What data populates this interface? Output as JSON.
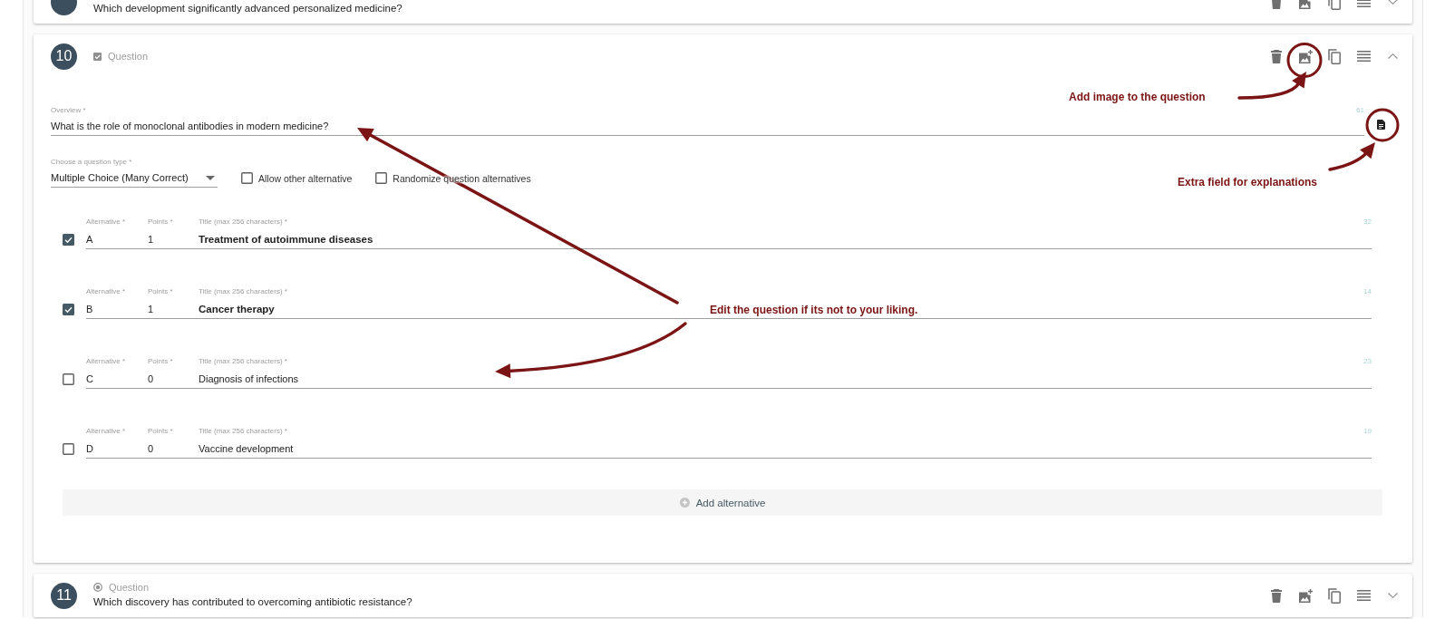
{
  "questions": [
    {
      "text": "Which development significantly advanced personalized medicine?",
      "expanded": false
    },
    {
      "number": "10",
      "type_label": "Question",
      "kind": "multiple",
      "expanded": true,
      "overview": {
        "label": "Overview *",
        "value": "What is the role of monoclonal antibodies in modern medicine?",
        "counter": "61"
      },
      "question_type": {
        "label": "Choose a question type *",
        "value": "Multiple Choice (Many Correct)"
      },
      "options": [
        {
          "label": "Allow other alternative",
          "checked": false
        },
        {
          "label": "Randomize question alternatives",
          "checked": false
        }
      ],
      "alternatives": [
        {
          "correct": true,
          "letter_label": "Alternative *",
          "letter": "A",
          "points_label": "Points *",
          "points": "1",
          "title_label": "Title (max 256 characters) *",
          "title": "Treatment of autoimmune diseases",
          "counter": "32"
        },
        {
          "correct": true,
          "letter_label": "Alternative *",
          "letter": "B",
          "points_label": "Points *",
          "points": "1",
          "title_label": "Title (max 256 characters) *",
          "title": "Cancer therapy",
          "counter": "14"
        },
        {
          "correct": false,
          "letter_label": "Alternative *",
          "letter": "C",
          "points_label": "Points *",
          "points": "0",
          "title_label": "Title (max 256 characters) *",
          "title": "Diagnosis of infections",
          "counter": "23"
        },
        {
          "correct": false,
          "letter_label": "Alternative *",
          "letter": "D",
          "points_label": "Points *",
          "points": "0",
          "title_label": "Title (max 256 characters) *",
          "title": "Vaccine development",
          "counter": "19"
        }
      ],
      "add_button": "Add alternative"
    },
    {
      "number": "11",
      "type_label": "Question",
      "kind": "single",
      "text": "Which discovery has contributed to overcoming antibiotic resistance?",
      "expanded": false
    }
  ],
  "annotations": [
    {
      "text": "Add image to the question"
    },
    {
      "text": "Extra field for explanations"
    },
    {
      "text": "Edit the question if its not to your liking."
    }
  ]
}
